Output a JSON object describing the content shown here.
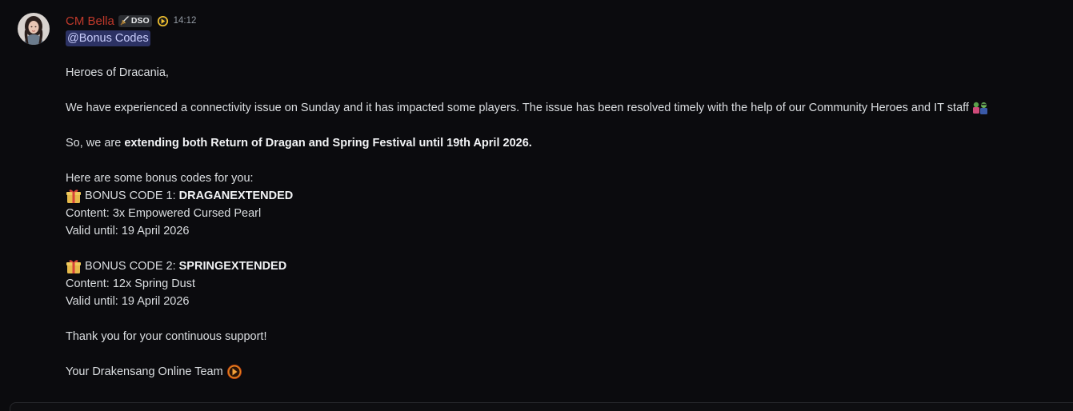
{
  "message": {
    "author": "CM Bella",
    "server_tag": "DSO",
    "timestamp": "14:12",
    "mention": "@Bonus Codes",
    "lines": {
      "greeting": "Heroes of Dracania,",
      "issue": "We have experienced a connectivity issue on Sunday and it has impacted some players. The issue has been resolved timely with the help of our Community Heroes and IT staff",
      "extend_prefix": "So, we are ",
      "extend_bold": "extending both Return of Dragan and Spring Festival until 19th April 2026.",
      "codes_intro": "Here are some bonus codes for you:",
      "code1_prefix": "BONUS CODE 1: ",
      "code1_value": "DRAGANEXTENDED",
      "code1_content": "Content: 3x Empowered Cursed Pearl",
      "code1_valid": "Valid until: 19 April 2026",
      "code2_prefix": "BONUS CODE 2: ",
      "code2_value": "SPRINGEXTENDED",
      "code2_content": "Content: 12x Spring Dust",
      "code2_valid": "Valid until: 19 April 2026",
      "thanks": "Thank you for your continuous support!",
      "signoff": "Your Drakensang Online Team"
    }
  },
  "colors": {
    "background": "#0b0b0e",
    "author": "#c0392b",
    "mention_bg": "#2c3264",
    "mention_text": "#c9cdfb",
    "text": "#dbdee1",
    "timestamp": "#949ba4"
  },
  "icons": {
    "tag": "sword-icon",
    "role": "drakensang-logo-icon",
    "issue_emoji": "pepe-heroes-emoji",
    "code_emoji": "gift-icon",
    "signoff_emoji": "drakensang-logo-icon"
  }
}
